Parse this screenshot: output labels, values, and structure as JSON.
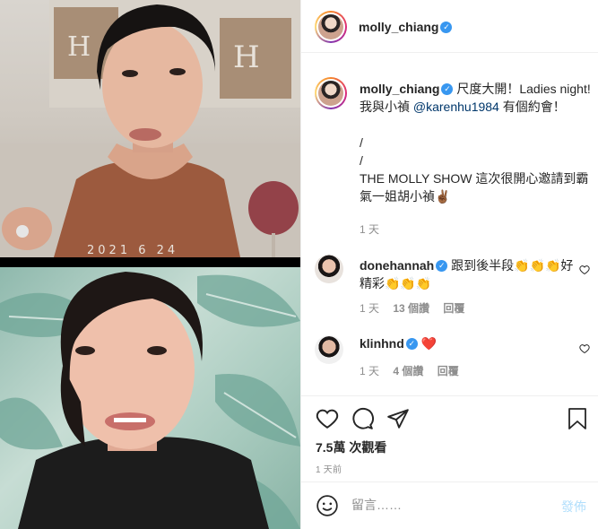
{
  "media": {
    "timestamp_overlay": "2021 6 24"
  },
  "header": {
    "username": "molly_chiang"
  },
  "caption": {
    "username": "molly_chiang",
    "text_part1": "尺度大開！Ladies night! 我與小禎 ",
    "mention": "@karenhu1984",
    "text_part2": " 有個約會！",
    "line2": "/",
    "line3": "/",
    "line4": "THE MOLLY SHOW 這次很開心邀請到霸氣一姐胡小禎✌🏾",
    "age": "1 天"
  },
  "comments": [
    {
      "username": "donehannah",
      "text": "跟到後半段👏👏👏好精彩👏👏👏",
      "age": "1 天",
      "likes": "13 個讚",
      "reply_label": "回覆"
    },
    {
      "username": "klinhnd",
      "text": "❤️",
      "age": "1 天",
      "likes": "4 個讚",
      "reply_label": "回覆"
    }
  ],
  "stats": {
    "views": "7.5萬 次觀看",
    "posted": "1 天前"
  },
  "composer": {
    "placeholder": "留言……",
    "post_label": "發佈"
  },
  "icons": {
    "like": "heart-icon",
    "comment": "comment-icon",
    "share": "share-icon",
    "save": "bookmark-icon",
    "emoji": "emoji-icon",
    "verified": "verified-badge-icon"
  }
}
